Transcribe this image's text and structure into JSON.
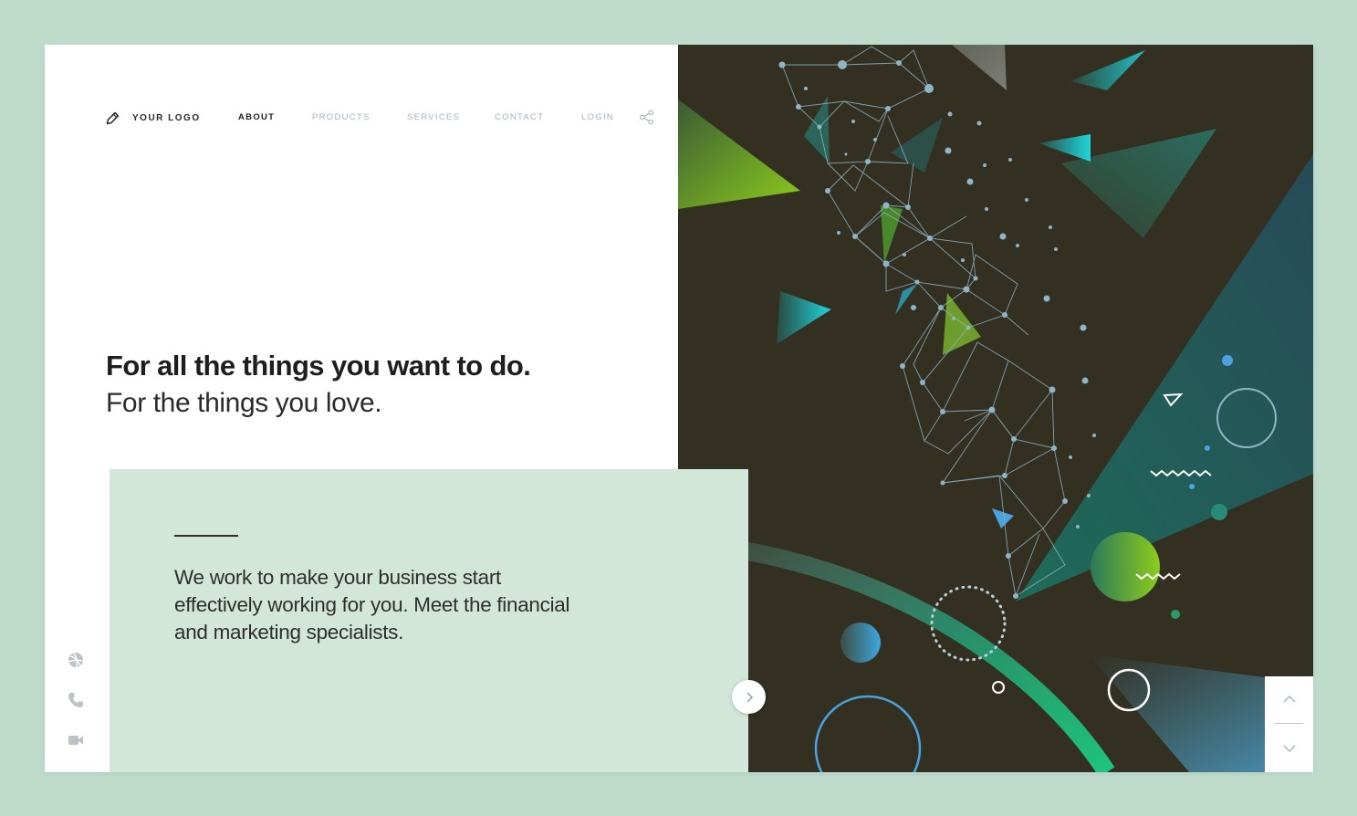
{
  "brand": {
    "logo_text": "YOUR LOGO",
    "logo_icon": "pencil-icon"
  },
  "nav": {
    "items": [
      {
        "label": "ABOUT",
        "active": true
      },
      {
        "label": "PRODUCTS",
        "active": false
      },
      {
        "label": "SERVICES",
        "active": false
      },
      {
        "label": "CONTACT",
        "active": false
      },
      {
        "label": "LOGIN",
        "active": false
      }
    ],
    "share_icon": "share-icon"
  },
  "hero": {
    "headline": "For all the things you want to do.",
    "subheadline": "For the things you love."
  },
  "card": {
    "text": "We work to make your business start effectively working for you. Meet the financial and marketing specialists.",
    "next_icon": "chevron-right-icon"
  },
  "side_icons": [
    "dribbble-icon",
    "phone-icon",
    "video-camera-icon"
  ],
  "scroll": {
    "up_icon": "chevron-up-icon",
    "down_icon": "chevron-down-icon"
  },
  "colors": {
    "page_background": "#bedbcb",
    "art_background": "#333021",
    "card_background": "#d2e7da",
    "accent_green": "#8dc63f",
    "accent_teal": "#2ec4c6",
    "accent_blue": "#4aa3df",
    "network_line": "#8fb4c6"
  }
}
